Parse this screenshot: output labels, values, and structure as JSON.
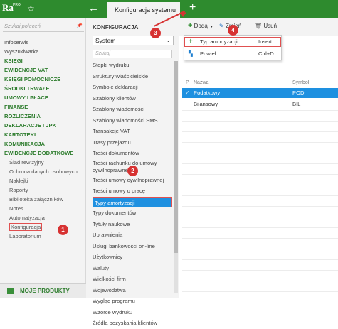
{
  "app": {
    "logo": "Ra",
    "logo_sub": "PRO",
    "tab_title": "Konfiguracja systemu"
  },
  "left": {
    "search_placeholder": "Szukaj poleceń",
    "items": [
      {
        "label": "Infoserwis",
        "type": "plain"
      },
      {
        "label": "Wyszukiwarka",
        "type": "plain"
      },
      {
        "label": "KSIĘGI",
        "type": "bold"
      },
      {
        "label": "EWIDENCJE VAT",
        "type": "bold"
      },
      {
        "label": "KSIĘGI POMOCNICZE",
        "type": "bold"
      },
      {
        "label": "ŚRODKI TRWAŁE",
        "type": "bold"
      },
      {
        "label": "UMOWY I PŁACE",
        "type": "bold"
      },
      {
        "label": "FINANSE",
        "type": "bold"
      },
      {
        "label": "ROZLICZENIA",
        "type": "bold"
      },
      {
        "label": "DEKLARACJE I JPK",
        "type": "bold"
      },
      {
        "label": "KARTOTEKI",
        "type": "bold"
      },
      {
        "label": "KOMUNIKACJA",
        "type": "bold"
      },
      {
        "label": "EWIDENCJE DODATKOWE",
        "type": "bold"
      },
      {
        "label": "Ślad rewizyjny",
        "type": "sub"
      },
      {
        "label": "Ochrona danych osobowych",
        "type": "sub"
      },
      {
        "label": "Naklejki",
        "type": "sub"
      },
      {
        "label": "Raporty",
        "type": "sub"
      },
      {
        "label": "Biblioteka załączników",
        "type": "sub"
      },
      {
        "label": "Notes",
        "type": "sub"
      },
      {
        "label": "Automatyzacja",
        "type": "sub"
      },
      {
        "label": "Konfiguracja",
        "type": "sub-selected"
      },
      {
        "label": "Laboratorium",
        "type": "sub"
      }
    ],
    "footer": "MOJE PRODUKTY"
  },
  "middle": {
    "title": "KONFIGURACJA",
    "select_value": "System",
    "search_placeholder": "Szukaj",
    "items": [
      "Stopki wydruku",
      "Struktury właścicielskie",
      "Symbole deklaracji",
      "Szablony klientów",
      "Szablony wiadomości",
      "Szablony wiadomości SMS",
      "Transakcje VAT",
      "Trasy przejazdu",
      "Treści dokumentów",
      "Treści rachunku do umowy cywilnoprawnej",
      "Treści umowy cywilnoprawnej",
      "Treści umowy o pracę",
      "Typy amortyzacji",
      "Typy dokumentów",
      "Tytuły naukowe",
      "Uprawnienia",
      "Usługi bankowości on-line",
      "Użytkownicy",
      "Waluty",
      "Wielkości firm",
      "Województwa",
      "Wygląd programu",
      "Wzorce wydruku",
      "Źródła pozyskania klientów"
    ],
    "selected_index": 12
  },
  "toolbar": {
    "add": "Dodaj",
    "edit": "Zmień",
    "delete": "Usuń"
  },
  "dropdown": [
    {
      "label": "Typ amortyzacji",
      "shortcut": "Insert"
    },
    {
      "label": "Powiel",
      "shortcut": "Ctrl+D"
    }
  ],
  "table": {
    "columns": [
      "P",
      "Nazwa",
      "Symbol"
    ],
    "rows": [
      {
        "check": "✓",
        "name": "Podatkowy",
        "symbol": "POD"
      },
      {
        "check": "",
        "name": "Bilansowy",
        "symbol": "BIL"
      }
    ]
  },
  "badges": [
    "1",
    "2",
    "3",
    "4"
  ],
  "colors": {
    "brand": "#2e8b2e",
    "selection": "#1e90e0",
    "annotation": "#d73232"
  }
}
